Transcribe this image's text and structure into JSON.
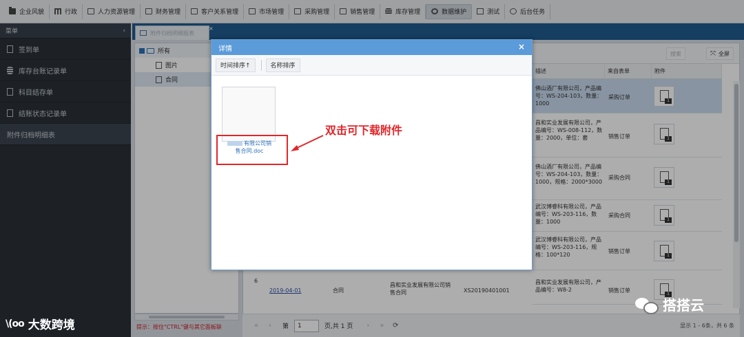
{
  "topmenu": [
    {
      "label": "企业风貌",
      "icon": "folder-icon"
    },
    {
      "label": "行政",
      "icon": "bank-icon"
    },
    {
      "label": "人力资源管理",
      "icon": "folder-open-icon"
    },
    {
      "label": "财务管理",
      "icon": "folder-open-icon"
    },
    {
      "label": "客户关系管理",
      "icon": "folder-open-icon"
    },
    {
      "label": "市场管理",
      "icon": "folder-open-icon"
    },
    {
      "label": "采购管理",
      "icon": "folder-open-icon"
    },
    {
      "label": "销售管理",
      "icon": "folder-open-icon"
    },
    {
      "label": "库存管理",
      "icon": "database-icon"
    },
    {
      "label": "数据维护",
      "icon": "wrench-icon"
    },
    {
      "label": "测试",
      "icon": "document-icon"
    },
    {
      "label": "后台任务",
      "icon": "info-icon"
    }
  ],
  "sidebar": {
    "title": "菜单",
    "collapse": "‹",
    "items": [
      {
        "label": "签到单"
      },
      {
        "label": "库存台账记录单"
      },
      {
        "label": "科目结存单"
      },
      {
        "label": "结账状态记录单"
      },
      {
        "label": "附件归档明细表"
      }
    ]
  },
  "tab": {
    "label": "附件归档明细报表",
    "close": "×"
  },
  "tree": {
    "root": "所有",
    "children": [
      "图片",
      "合同"
    ]
  },
  "hint": "提示：按住\"CTRL\"键与其它面板联",
  "grid": {
    "toolbar": {
      "search": "搜索",
      "fullscreen": "全屏"
    },
    "headers": {
      "desc": "描述",
      "source": "来自表单",
      "attach": "附件"
    },
    "rows": [
      {
        "desc": "佛山酒厂有限公司，产品编号：WS-204-103，数量：1000",
        "source": "采购订单",
        "count": "1"
      },
      {
        "desc": "昌和实业发展有限公司，产品编号：WS-008-112，数量：2000，单位：套",
        "source": "销售订单",
        "count": "1"
      },
      {
        "desc": "佛山酒厂有限公司，产品编号：WS-204-103，数量：1000，规格：2000*3000",
        "source": "采购合同",
        "count": "1"
      },
      {
        "desc": "武汉博睿科有限公司，产品编号：WS-203-116，数量：1000",
        "source": "采购合同",
        "count": "1"
      },
      {
        "desc": "武汉博睿科有限公司，产品编号：WS-203-116，规格：100*120",
        "source": "销售订单",
        "count": "1"
      },
      {
        "desc": "昌和实业发展有限公司，产品编号：W8-2",
        "source": "销售订单",
        "count": "1"
      }
    ],
    "row6": {
      "num": "6",
      "date": "2019-04-01",
      "type": "合同",
      "name": "昌和实业发展有限公司销售合同",
      "code": "XS20190401001"
    }
  },
  "pager": {
    "page_label": "第",
    "page_value": "1",
    "total": "页,共 1 页",
    "status": "显示 1 - 6条，共 6 条"
  },
  "modal": {
    "title": "详情",
    "close": "×",
    "sort_time": "时间排序↑",
    "sort_name": "名称排序",
    "file_name_line1": "有限公司销",
    "file_name_line2": "售合同.doc",
    "callout": "双击可下载附件"
  },
  "watermarks": {
    "left_logo": "\\(oo",
    "left_text": "大数跨境",
    "right_text": "搭搭云"
  },
  "colors": {
    "accent": "#5b9bd9",
    "callout": "#e0262a",
    "tab_bar": "#1f5c8f"
  }
}
